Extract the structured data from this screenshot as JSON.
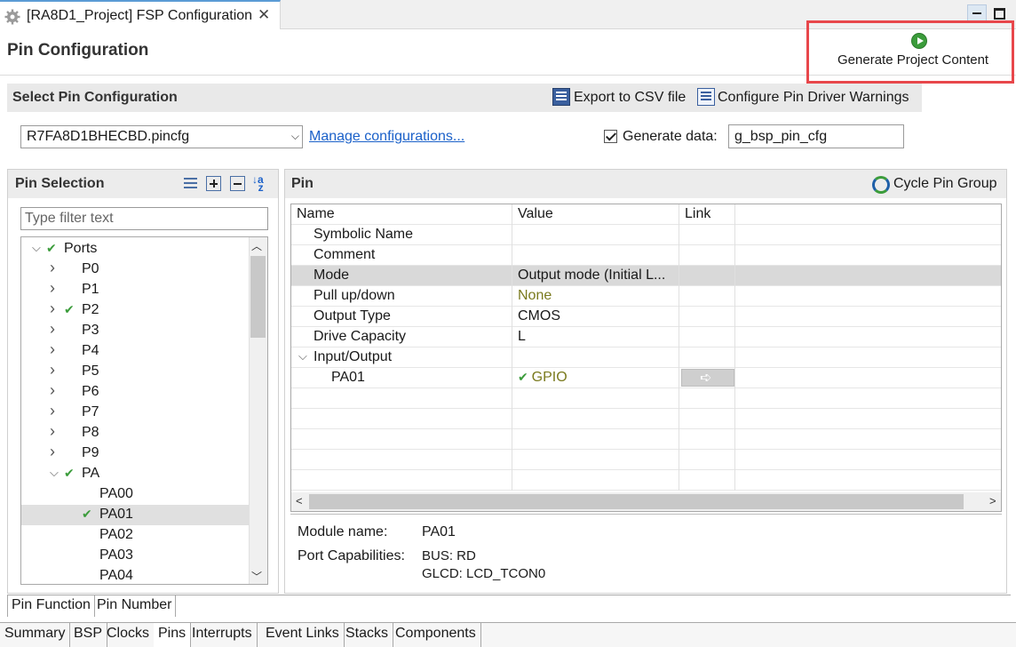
{
  "editor_tab": {
    "title": "[RA8D1_Project] FSP Configuration",
    "close": "✕"
  },
  "page_title": "Pin Configuration",
  "generate_button": {
    "label": "Generate Project Content"
  },
  "select_pin_config": {
    "title": "Select Pin Configuration",
    "export_csv": "Export to CSV file",
    "configure_warnings": "Configure Pin Driver Warnings",
    "config_file": "R7FA8D1BHECBD.pincfg",
    "manage_link": "Manage configurations...",
    "generate_data_label": "Generate data:",
    "generate_data_checked": true,
    "generate_data_value": "g_bsp_pin_cfg"
  },
  "pin_selection": {
    "title": "Pin Selection",
    "filter_placeholder": "Type filter text",
    "tree": [
      {
        "label": "Ports",
        "expanded": true,
        "checked": true,
        "level": 0
      },
      {
        "label": "P0",
        "expanded": false,
        "checked": false,
        "level": 1
      },
      {
        "label": "P1",
        "expanded": false,
        "checked": false,
        "level": 1
      },
      {
        "label": "P2",
        "expanded": false,
        "checked": true,
        "level": 1
      },
      {
        "label": "P3",
        "expanded": false,
        "checked": false,
        "level": 1
      },
      {
        "label": "P4",
        "expanded": false,
        "checked": false,
        "level": 1
      },
      {
        "label": "P5",
        "expanded": false,
        "checked": false,
        "level": 1
      },
      {
        "label": "P6",
        "expanded": false,
        "checked": false,
        "level": 1
      },
      {
        "label": "P7",
        "expanded": false,
        "checked": false,
        "level": 1
      },
      {
        "label": "P8",
        "expanded": false,
        "checked": false,
        "level": 1
      },
      {
        "label": "P9",
        "expanded": false,
        "checked": false,
        "level": 1
      },
      {
        "label": "PA",
        "expanded": true,
        "checked": true,
        "level": 1
      },
      {
        "label": "PA00",
        "checked": false,
        "level": 2
      },
      {
        "label": "PA01",
        "checked": true,
        "level": 2,
        "selected": true
      },
      {
        "label": "PA02",
        "checked": false,
        "level": 2
      },
      {
        "label": "PA03",
        "checked": false,
        "level": 2
      },
      {
        "label": "PA04",
        "checked": false,
        "level": 2
      }
    ]
  },
  "pin_panel": {
    "title": "Pin",
    "cycle_label": "Cycle Pin Group",
    "columns": [
      "Name",
      "Value",
      "Link"
    ],
    "rows": [
      {
        "name": "Symbolic Name",
        "value": ""
      },
      {
        "name": "Comment",
        "value": ""
      },
      {
        "name": "Mode",
        "value": "Output mode (Initial L...",
        "highlight": true
      },
      {
        "name": "Pull up/down",
        "value": "None",
        "olive": true
      },
      {
        "name": "Output Type",
        "value": "CMOS"
      },
      {
        "name": "Drive Capacity",
        "value": "L"
      },
      {
        "name": "Input/Output",
        "value": "",
        "expander": true
      },
      {
        "name": "PA01",
        "value": "GPIO",
        "olive": true,
        "checked": true,
        "nested": true,
        "link": true
      }
    ]
  },
  "module_info": {
    "module_name_label": "Module name:",
    "module_name": "PA01",
    "port_cap_label": "Port Capabilities:",
    "capabilities": [
      "BUS: RD",
      "GLCD: LCD_TCON0"
    ]
  },
  "inner_tabs": [
    "Pin Function",
    "Pin Number"
  ],
  "bottom_tabs": [
    "Summary",
    "BSP",
    "Clocks",
    "Pins",
    "Interrupts",
    "Event Links",
    "Stacks",
    "Components"
  ],
  "active_bottom_tab": "Pins",
  "colors": {
    "accent_red": "#e8474b",
    "check_green": "#3b9c3b",
    "link_blue": "#1b61c9"
  }
}
